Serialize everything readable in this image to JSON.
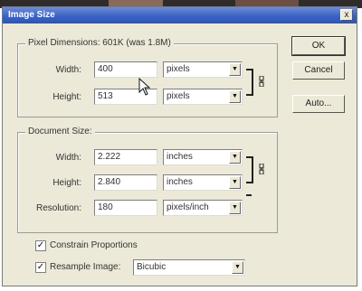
{
  "window": {
    "title": "Image Size",
    "close_label": "x"
  },
  "pixel_dimensions": {
    "legend": "Pixel Dimensions:  601K (was 1.8M)",
    "width_label": "Width:",
    "width_value": "400",
    "width_unit": "pixels",
    "height_label": "Height:",
    "height_value": "513",
    "height_unit": "pixels"
  },
  "document_size": {
    "legend": "Document Size:",
    "width_label": "Width:",
    "width_value": "2.222",
    "width_unit": "inches",
    "height_label": "Height:",
    "height_value": "2.840",
    "height_unit": "inches",
    "resolution_label": "Resolution:",
    "resolution_value": "180",
    "resolution_unit": "pixels/inch"
  },
  "options": {
    "constrain_label": "Constrain Proportions",
    "constrain_checked": true,
    "resample_label": "Resample Image:",
    "resample_checked": true,
    "resample_method": "Bicubic"
  },
  "buttons": {
    "ok": "OK",
    "cancel": "Cancel",
    "auto": "Auto..."
  },
  "icons": {
    "dropdown": "chevron-down-icon",
    "check": "checkmark-icon",
    "link": "chain-link-icon",
    "cursor": "mouse-pointer-icon"
  }
}
